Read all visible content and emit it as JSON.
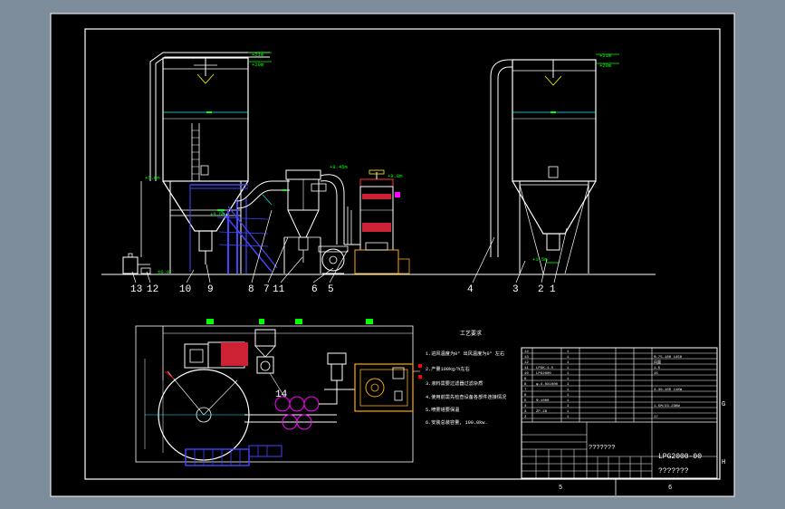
{
  "drawing": {
    "title": "LPG2000-00",
    "title_placeholder_1": "???????",
    "title_placeholder_2": "???????",
    "zone_numbers": [
      "5",
      "6"
    ],
    "zone_letters": [
      "G",
      "H"
    ]
  },
  "elevation_labels": {
    "left_top_1": "+21m",
    "left_top_2": "+20m",
    "left_mid": "+9.5m",
    "left_low": "+5.0m",
    "cyclone_top": "+8.45m",
    "scrubber_top": "+8.8m",
    "ground": "±0.0",
    "right_top_1": "+21m",
    "right_top_2": "+20m",
    "right_low": "+1.5m"
  },
  "part_numbers_left": [
    "13",
    "12",
    "10",
    "9",
    "8",
    "7",
    "11",
    "6",
    "5"
  ],
  "part_numbers_right": [
    "4",
    "3",
    "2",
    "1"
  ],
  "plan_part_number": "14",
  "notes": {
    "heading": "工艺要求",
    "lines": [
      "1.进风温度为0° 出风温度为0° 左右",
      "2.产量100kg/h左右",
      "3.液料需要过滤器过滤杂质",
      "4.使用前需先检查设备各部件连接情况",
      "5.喷雾塔要保温",
      "6.安装总装容量, 190.0kw."
    ]
  },
  "parts_table": {
    "rows": [
      [
        "14",
        "",
        "1",
        "",
        ""
      ],
      [
        "13",
        "",
        "1",
        "",
        "Φ-75-180 1450"
      ],
      [
        "12",
        "",
        "1",
        "",
        "风量"
      ],
      [
        "11",
        "LPGK-1.5",
        "1",
        "",
        "1.5"
      ],
      [
        "10",
        "LPG2000",
        "1",
        "",
        "15"
      ],
      [
        "9",
        "",
        "1",
        "",
        ""
      ],
      [
        "8",
        "φ-4.0X1000",
        "1",
        "",
        ""
      ],
      [
        "7",
        "",
        "1",
        "",
        "4-36-10D 11KW"
      ],
      [
        "6",
        "",
        "1",
        "",
        ""
      ],
      [
        "5",
        "Φ-1000",
        "1",
        "",
        ""
      ],
      [
        "4",
        "",
        "1",
        "",
        "1.5M/23-23KW"
      ],
      [
        "3",
        "ZP-28",
        "1",
        "",
        ""
      ],
      [
        "2",
        "",
        "1",
        "",
        "17"
      ]
    ]
  }
}
